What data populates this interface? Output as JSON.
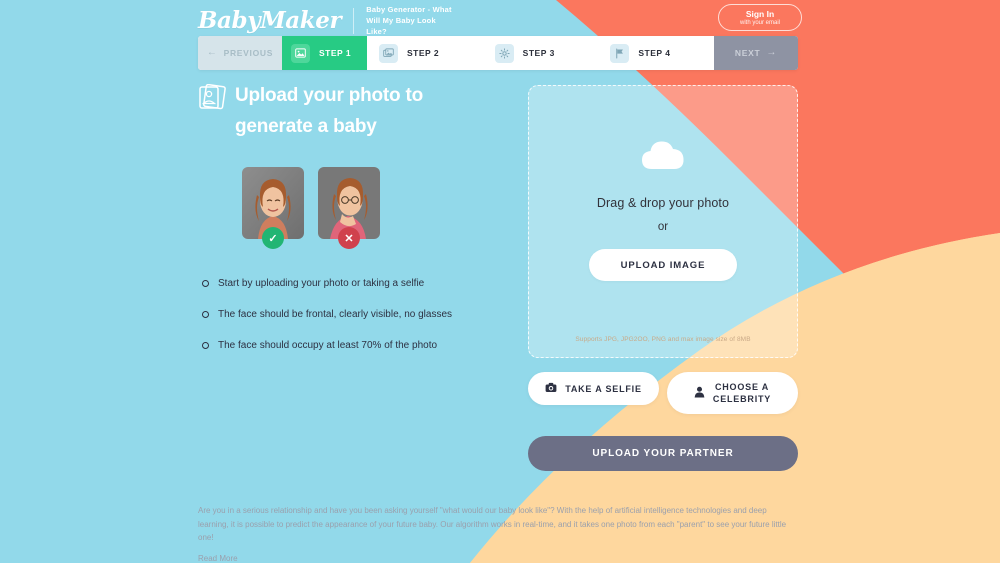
{
  "header": {
    "logo": "BabyMaker",
    "tagline": "Baby Generator - What Will My Baby Look Like?",
    "signin_main": "Sign In",
    "signin_sub": "with your email"
  },
  "stepbar": {
    "previous_label": "PREVIOUS",
    "next_label": "NEXT",
    "steps": [
      {
        "label": "STEP 1",
        "icon": "image-icon",
        "active": true
      },
      {
        "label": "STEP 2",
        "icon": "photos-icon",
        "active": false
      },
      {
        "label": "STEP 3",
        "icon": "gear-icon",
        "active": false
      },
      {
        "label": "STEP 4",
        "icon": "flag-icon",
        "active": false
      }
    ]
  },
  "main": {
    "title_line1": "Upload your photo to",
    "title_line2": "generate a baby",
    "samples": [
      {
        "status": "good",
        "badge": "check-icon"
      },
      {
        "status": "bad",
        "badge": "cross-icon"
      }
    ],
    "bullets": [
      "Start by uploading your photo or taking a selfie",
      "The face should be frontal, clearly visible, no glasses",
      "The face should occupy at least 70% of the photo"
    ]
  },
  "dropzone": {
    "icon": "cloud-upload-icon",
    "headline": "Drag & drop your photo",
    "or": "or",
    "upload_button": "UPLOAD IMAGE",
    "note": "Supports JPG, JPG2OO, PNG and max image size of 8MB"
  },
  "actions": {
    "selfie_label": "TAKE A SELFIE",
    "selfie_icon": "camera-icon",
    "celebrity_label_line1": "CHOOSE A",
    "celebrity_label_line2": "CELEBRITY",
    "celebrity_icon": "person-icon",
    "partner_label": "UPLOAD YOUR PARTNER"
  },
  "footer": {
    "paragraph": "Are you in a serious relationship and have you been asking yourself \"what would our baby look like\"? With the help of artificial intelligence technologies and deep learning, it is possible to predict the appearance of your future baby. Our algorithm works in real-time, and it takes one photo from each \"parent\" to see your future little one!",
    "read_more": "Read More"
  },
  "colors": {
    "background_blue": "#92d9ea",
    "coral": "#fb775e",
    "peach": "#fed79e",
    "green_active": "#27cb84",
    "slate": "#6c6f86",
    "text_dark": "#2d3142"
  }
}
